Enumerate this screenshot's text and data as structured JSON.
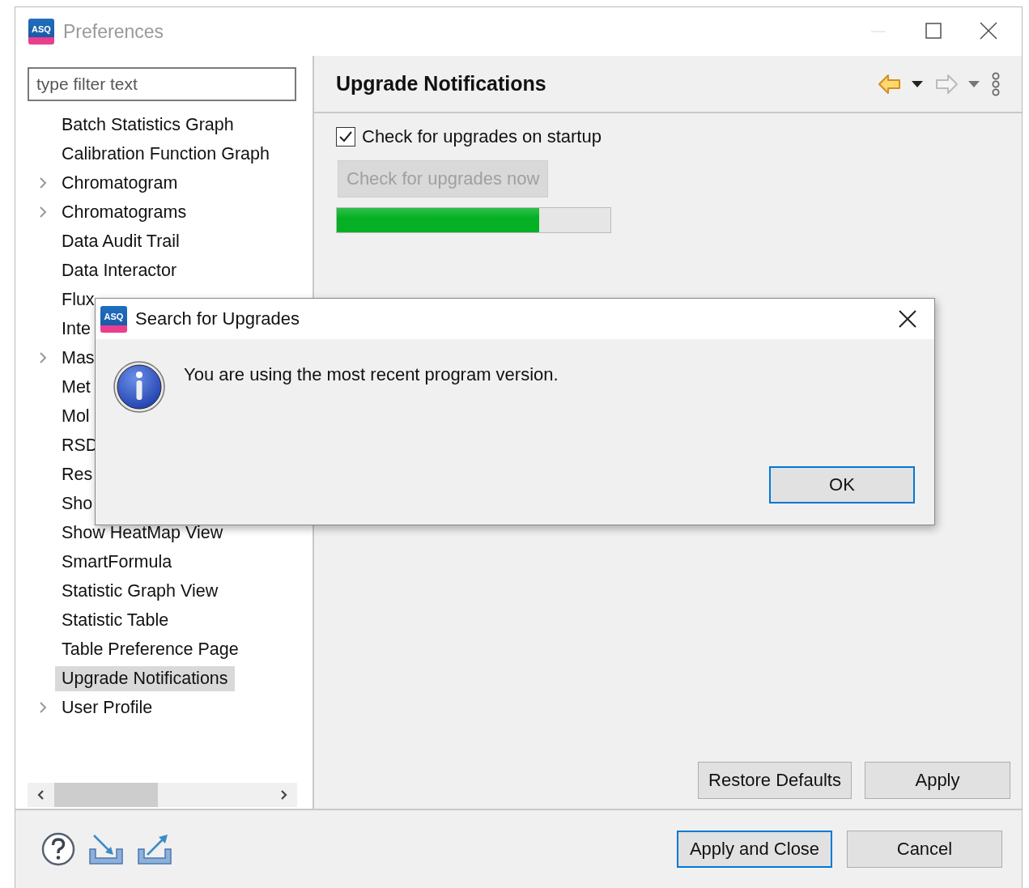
{
  "window": {
    "title": "Preferences",
    "logo_text": "ASQ",
    "minimize_disabled": true
  },
  "filter": {
    "placeholder": "type filter text"
  },
  "tree": {
    "items": [
      {
        "label": "Batch Statistics Graph",
        "kind": "leaf",
        "selected": false
      },
      {
        "label": "Calibration Function Graph",
        "kind": "leaf",
        "selected": false
      },
      {
        "label": "Chromatogram",
        "kind": "group",
        "selected": false
      },
      {
        "label": "Chromatograms",
        "kind": "group",
        "selected": false
      },
      {
        "label": "Data Audit Trail",
        "kind": "leaf",
        "selected": false
      },
      {
        "label": "Data Interactor",
        "kind": "leaf",
        "selected": false
      },
      {
        "label": "Flux",
        "kind": "leaf",
        "selected": false
      },
      {
        "label": "Inte",
        "kind": "leaf",
        "selected": false
      },
      {
        "label": "Mas",
        "kind": "group",
        "selected": false
      },
      {
        "label": "Met",
        "kind": "leaf",
        "selected": false
      },
      {
        "label": "Mol",
        "kind": "leaf",
        "selected": false
      },
      {
        "label": "RSD",
        "kind": "leaf",
        "selected": false
      },
      {
        "label": "Res",
        "kind": "leaf",
        "selected": false
      },
      {
        "label": "Sho",
        "kind": "leaf",
        "selected": false
      },
      {
        "label": "Show HeatMap View",
        "kind": "leaf",
        "selected": false
      },
      {
        "label": "SmartFormula",
        "kind": "leaf",
        "selected": false
      },
      {
        "label": "Statistic Graph View",
        "kind": "leaf",
        "selected": false
      },
      {
        "label": "Statistic Table",
        "kind": "leaf",
        "selected": false
      },
      {
        "label": "Table Preference Page",
        "kind": "leaf",
        "selected": false
      },
      {
        "label": "Upgrade Notifications",
        "kind": "leaf",
        "selected": true
      },
      {
        "label": "User Profile",
        "kind": "group",
        "selected": false
      }
    ]
  },
  "page": {
    "title": "Upgrade Notifications",
    "nav": [
      {
        "kind": "back",
        "disabled": false
      },
      {
        "kind": "forward",
        "disabled": true
      }
    ],
    "checkbox": {
      "label": "Check for upgrades on startup",
      "checked": true
    },
    "check_button": {
      "label": "Check for upgrades now",
      "disabled": true
    },
    "progress": {
      "level": 0.74
    },
    "buttons": [
      {
        "label": "Restore Defaults"
      },
      {
        "label": "Apply"
      }
    ]
  },
  "footer": {
    "buttons": [
      {
        "label": "Apply and Close",
        "default": true
      },
      {
        "label": "Cancel",
        "default": false
      }
    ]
  },
  "dialog": {
    "title": "Search for Upgrades",
    "logo_text": "ASQ",
    "message": "You are using the most recent program version.",
    "buttons": [
      {
        "label": "OK",
        "default": true
      }
    ]
  }
}
